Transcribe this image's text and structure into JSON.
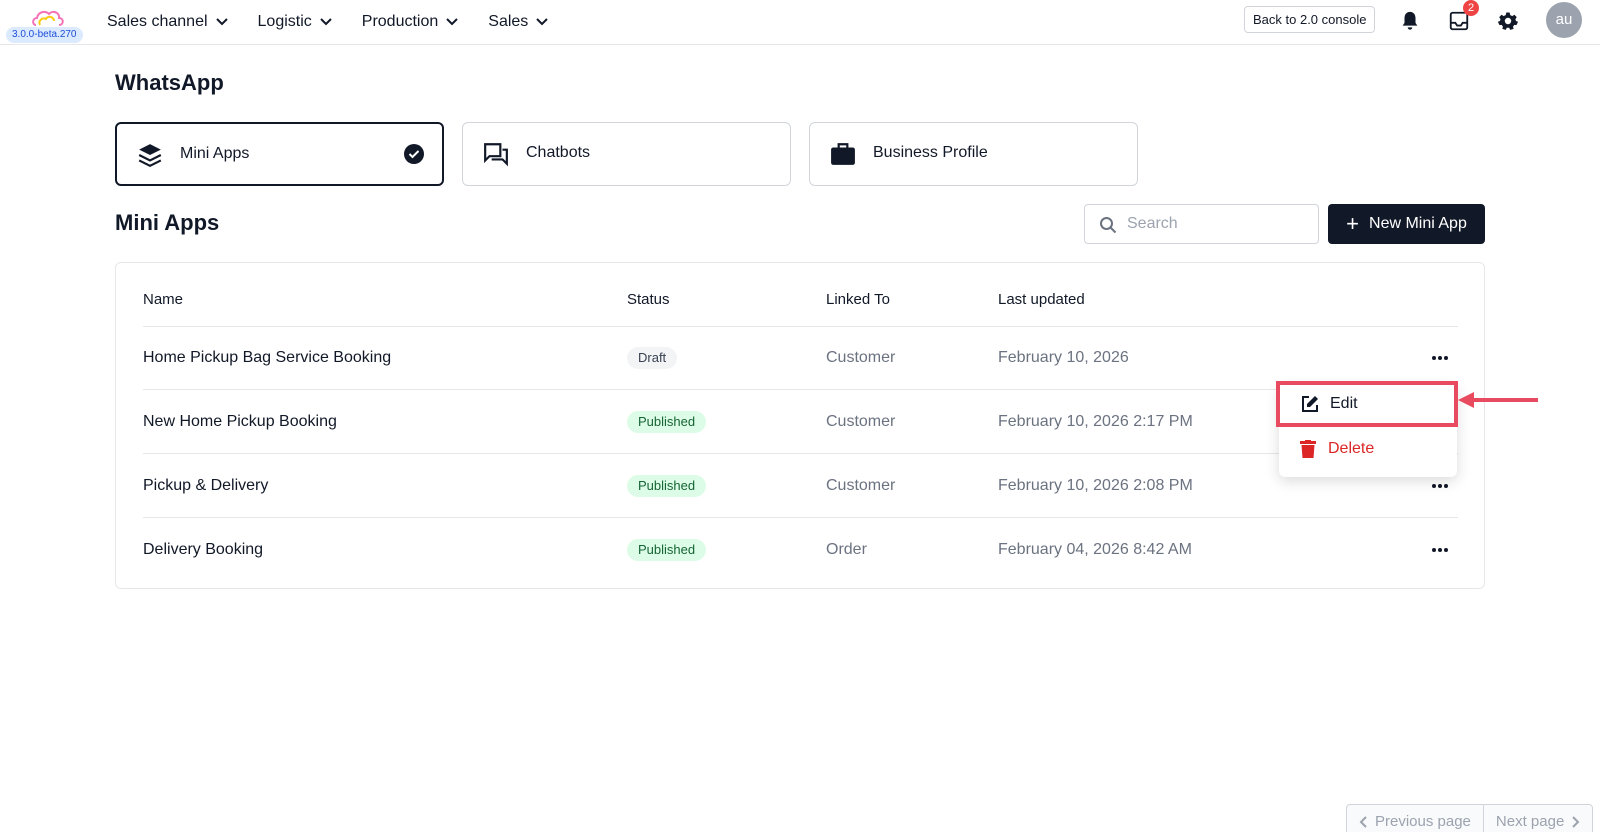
{
  "app": {
    "version": "3.0.0-beta.270",
    "notification_count": "2",
    "avatar_initials": "au",
    "back_button": "Back to 2.0 console",
    "icons": [
      "cloud-logo-icon",
      "bell-icon",
      "inbox-icon",
      "gear-icon"
    ]
  },
  "nav": {
    "items": [
      {
        "label": "Sales channel"
      },
      {
        "label": "Logistic"
      },
      {
        "label": "Production"
      },
      {
        "label": "Sales"
      }
    ]
  },
  "page": {
    "title": "WhatsApp"
  },
  "cards": [
    {
      "label": "Mini Apps",
      "icon": "layers-icon",
      "selected": true
    },
    {
      "label": "Chatbots",
      "icon": "chat-bubbles-icon",
      "selected": false
    },
    {
      "label": "Business Profile",
      "icon": "briefcase-icon",
      "selected": false
    }
  ],
  "section": {
    "title": "Mini Apps",
    "search_placeholder": "Search",
    "new_button": "New Mini App"
  },
  "table": {
    "columns": [
      "Name",
      "Status",
      "Linked To",
      "Last updated"
    ],
    "rows": [
      {
        "name": "Home Pickup Bag Service Booking",
        "status": "Draft",
        "linked_to": "Customer",
        "last_updated": "February 10, 2026"
      },
      {
        "name": "New Home Pickup Booking",
        "status": "Published",
        "linked_to": "Customer",
        "last_updated": "February 10, 2026 2:17 PM"
      },
      {
        "name": "Pickup & Delivery",
        "status": "Published",
        "linked_to": "Customer",
        "last_updated": "February 10, 2026 2:08 PM"
      },
      {
        "name": "Delivery Booking",
        "status": "Published",
        "linked_to": "Order",
        "last_updated": "February 04, 2026 8:42 AM"
      }
    ]
  },
  "menu": {
    "edit": "Edit",
    "delete": "Delete"
  },
  "pagination": {
    "previous": "Previous page",
    "next": "Next page"
  },
  "colors": {
    "primary": "#111827",
    "highlight": "#e84b60",
    "danger": "#dc2626",
    "published_bg": "#dcfce7",
    "published_text": "#166534"
  }
}
